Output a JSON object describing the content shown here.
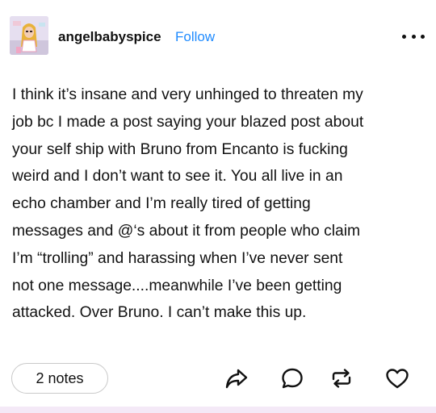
{
  "post": {
    "username": "angelbabyspice",
    "follow_label": "Follow",
    "lines": [
      "I think it’s insane and very unhinged to threaten my",
      "job bc I made a post saying your blazed post about",
      "your self ship with Bruno from Encanto is fucking",
      "weird and I don’t want to see it. You all live in an",
      "echo chamber and I’m really tired of getting",
      "messages and @‘s about it from people who claim",
      "I’m “trolling” and harassing when I’ve never sent",
      "not one message....meanwhile I’ve been getting",
      "attacked. Over Bruno. I can’t make this up."
    ],
    "notes_label": "2 notes"
  },
  "icons": {
    "more": "more-horizontal-icon",
    "share": "share-arrow-icon",
    "reply": "reply-bubble-icon",
    "reblog": "reblog-icon",
    "like": "heart-icon"
  },
  "colors": {
    "accent": "#1f8bff",
    "text": "#121212",
    "bottom_strip": "#f4e9f7"
  }
}
